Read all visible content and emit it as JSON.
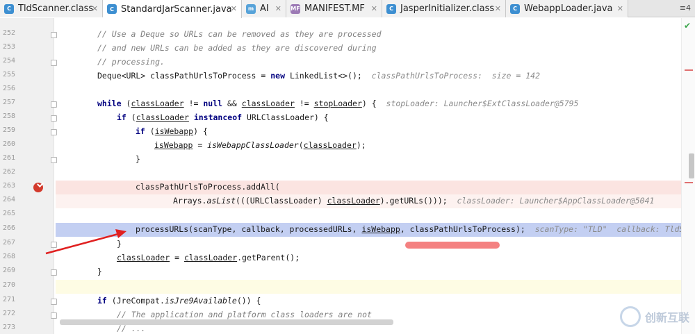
{
  "tabs": [
    {
      "label": "TldScanner.class",
      "icon": "class-file-icon",
      "icon_color": "#3d8fd1",
      "active": false
    },
    {
      "label": "StandardJarScanner.java",
      "icon": "java-class-icon",
      "icon_color": "#3d8fd1",
      "active": true
    },
    {
      "label": "AI",
      "icon": "interface-icon",
      "icon_color": "#57a3d9",
      "active": false
    },
    {
      "label": "MANIFEST.MF",
      "icon": "manifest-file-icon",
      "icon_color": "#9c7ab5",
      "active": false
    },
    {
      "label": "JasperInitializer.class",
      "icon": "class-file-icon",
      "icon_color": "#3d8fd1",
      "active": false
    },
    {
      "label": "WebappLoader.java",
      "icon": "java-class-icon",
      "icon_color": "#3d8fd1",
      "active": false
    }
  ],
  "tab_overflow_label": "≡4",
  "line_numbers": [
    "252",
    "253",
    "254",
    "255",
    "256",
    "257",
    "258",
    "259",
    "260",
    "261",
    "262",
    "263",
    "264",
    "265",
    "266",
    "267",
    "268",
    "269",
    "270",
    "271",
    "272",
    "273"
  ],
  "code": {
    "l252": "// Use a Deque so URLs can be removed as they are processed",
    "l253": "// and new URLs can be added as they are discovered during",
    "l254": "// processing.",
    "l255_a": "Deque<URL> classPathUrlsToProcess = ",
    "l255_kw": "new",
    "l255_b": " LinkedList<>();",
    "l255_hint": "classPathUrlsToProcess:  size = 142",
    "l257_kw1": "while",
    "l257_a": " (",
    "l257_v1": "classLoader",
    "l257_b": " != ",
    "l257_kw2": "null",
    "l257_c": " && ",
    "l257_v2": "classLoader",
    "l257_d": " != ",
    "l257_v3": "stopLoader",
    "l257_e": ") {",
    "l257_hint": "stopLoader: Launcher$ExtClassLoader@5795",
    "l258_kw1": "if",
    "l258_a": " (",
    "l258_v1": "classLoader",
    "l258_kw2": " instanceof",
    "l258_b": " URLClassLoader) {",
    "l259_kw": "if",
    "l259_a": " (",
    "l259_v": "isWebapp",
    "l259_b": ") {",
    "l260_v": "isWebapp",
    "l260_a": " = ",
    "l260_m": "isWebappClassLoader",
    "l260_b": "(",
    "l260_v2": "classLoader",
    "l260_c": ");",
    "l261": "}",
    "l263": "classPathUrlsToProcess.addAll(",
    "l264_a": "Arrays.",
    "l264_m": "asList",
    "l264_b": "(((URLClassLoader) ",
    "l264_v": "classLoader",
    "l264_c": ").getURLs()));",
    "l264_hint": "classLoader: Launcher$AppClassLoader@5041",
    "l266_a": "processURLs(scanType, callback, processedURLs, ",
    "l266_v": "isWebapp",
    "l266_b": ", classPathUrlsToProcess);",
    "l266_hint": "scanType: \"TLD\"  callback: TldScann",
    "l267": "}",
    "l268_v1": "classLoader",
    "l268_a": " = ",
    "l268_v2": "classLoader",
    "l268_b": ".getParent();",
    "l269": "}",
    "l271_kw": "if",
    "l271_a": " (JreCompat.",
    "l271_m": "isJre9Available",
    "l271_b": "()) {",
    "l272": "// The application and platform class loaders are not",
    "l273": "// ..."
  },
  "watermark": {
    "text": "创新互联"
  },
  "colors": {
    "execution_line": "#c3cff2",
    "breakpoint_line": "#fbe4e1",
    "keyword": "#000080",
    "comment": "#808080",
    "annotation_arrow": "#e02020",
    "annotation_mark": "#f26b6b"
  }
}
